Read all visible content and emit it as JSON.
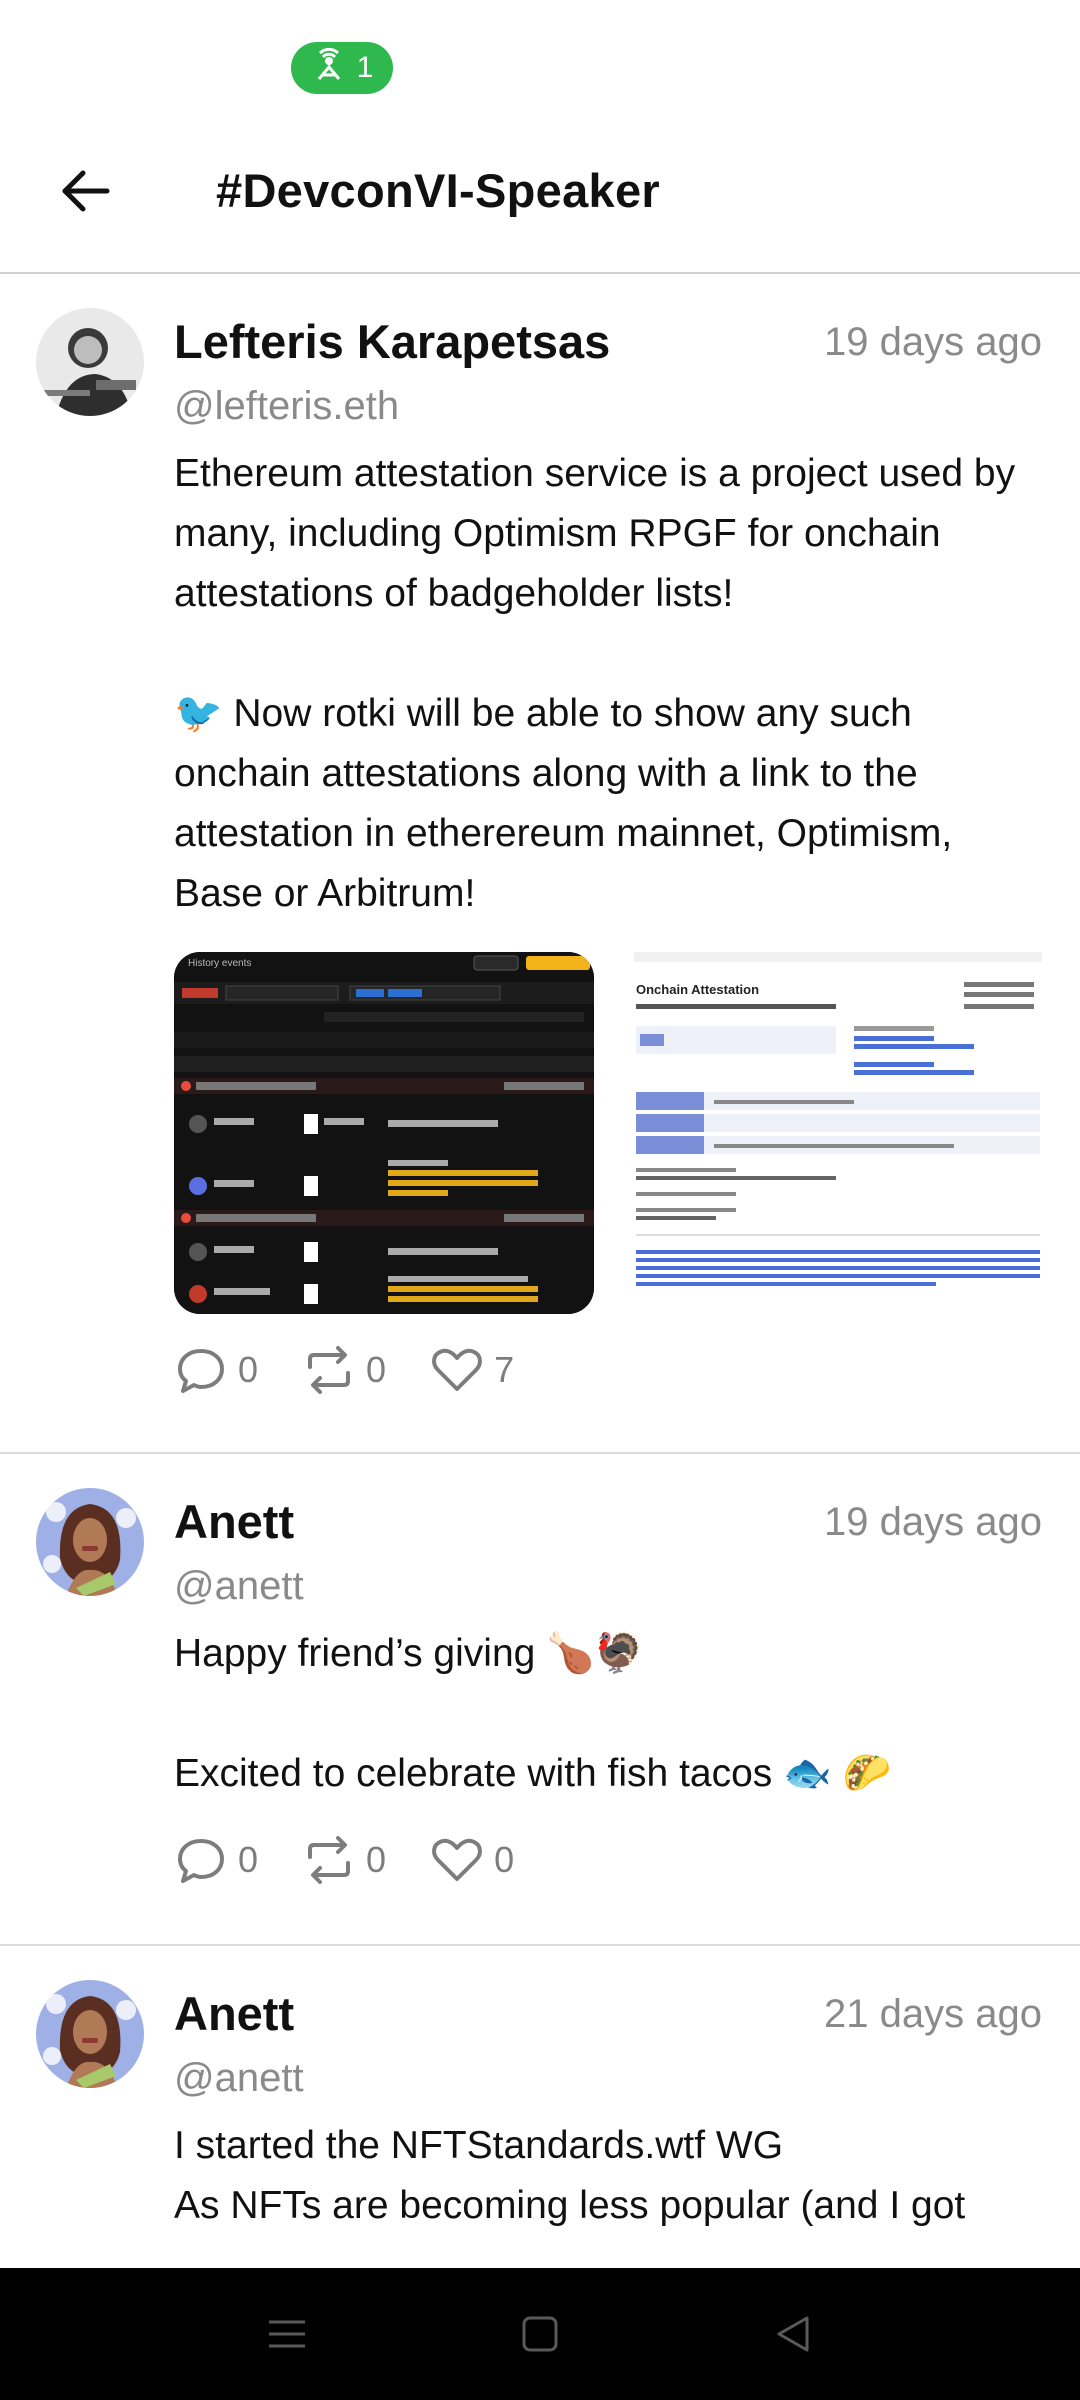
{
  "status_bar": {
    "hotspot_count": "1",
    "hotspot_icon": "hotspot-icon",
    "accent": "#2fb84e"
  },
  "header": {
    "title": "#DevconVI-Speaker",
    "back_icon": "arrow-left-icon"
  },
  "posts": [
    {
      "author": "Lefteris Karapetsas",
      "handle": "@lefteris.eth",
      "time": "19 days ago",
      "text": "Ethereum attestation service is a project used by many, including Optimism RPGF for onchain attestations of badgeholder lists!\n\n🐦 Now rotki will be able to show any such onchain attestations along with a link to the attestation in ethererеum mainnet, Optimism, Base or Arbitrum!",
      "media_titles": [
        "History events",
        "Onchain Attestation"
      ],
      "replies": "0",
      "reposts": "0",
      "likes": "7"
    },
    {
      "author": "Anett",
      "handle": "@anett",
      "time": "19 days ago",
      "text": "Happy friend’s giving 🍗🦃\n\nExcited to celebrate with fish tacos 🐟 🌮",
      "replies": "0",
      "reposts": "0",
      "likes": "0"
    },
    {
      "author": "Anett",
      "handle": "@anett",
      "time": "21 days ago",
      "text": "I started the NFTStandards.wtf WG\nAs NFTs are becoming less popular (and I got"
    }
  ],
  "nav": {
    "menu_icon": "menu-icon",
    "home_icon": "home-square-icon",
    "back_icon": "triangle-back-icon"
  }
}
